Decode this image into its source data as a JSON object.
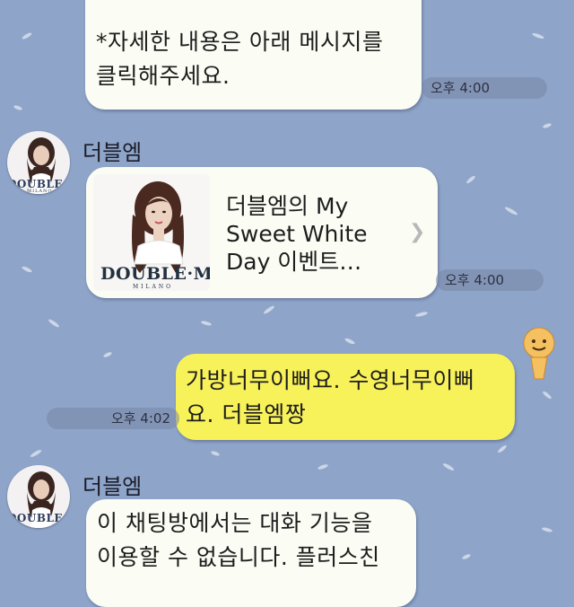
{
  "messages": [
    {
      "text": "*자세한 내용은 아래 메시지를\n클릭해주세요.",
      "time": "오후 4:00"
    },
    {
      "sender": "더블엠",
      "card": {
        "title": "더블엠의 My\nSweet White\nDay 이벤트…",
        "brand": "DOUBLE·M",
        "brand_sub": "MILANO"
      },
      "time": "오후 4:00"
    },
    {
      "text": "가방너무이뻐요. 수영너무이뻐\n요. 더블엠짱",
      "time": "오후 4:02",
      "outgoing": true
    },
    {
      "sender": "더블엠",
      "text": "이 채팅방에서는 대화 기능을\n이용할 수 없습니다. 플러스친"
    }
  ],
  "avatar_brand": "DOUBLE·M",
  "avatar_sub": "MILANO",
  "colors": {
    "background": "#8ea4c9",
    "bubble_in": "#fbfdf4",
    "bubble_out": "#f8f25a"
  }
}
